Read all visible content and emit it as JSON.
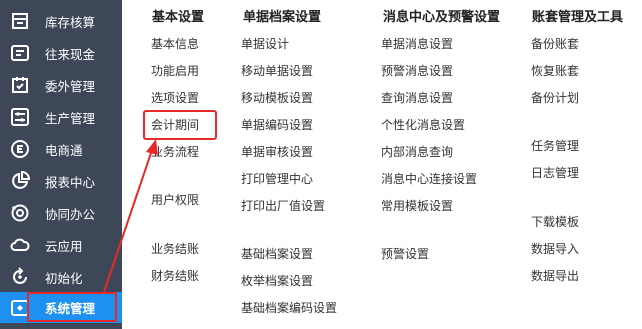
{
  "sidebar": {
    "items": [
      {
        "label": "库存核算",
        "icon": "inventory-icon"
      },
      {
        "label": "往来现金",
        "icon": "cash-icon"
      },
      {
        "label": "委外管理",
        "icon": "outsource-icon"
      },
      {
        "label": "生产管理",
        "icon": "production-icon"
      },
      {
        "label": "电商通",
        "icon": "ecommerce-icon"
      },
      {
        "label": "报表中心",
        "icon": "pie-chart-icon"
      },
      {
        "label": "协同办公",
        "icon": "collaboration-icon"
      },
      {
        "label": "云应用",
        "icon": "cloud-icon"
      },
      {
        "label": "初始化",
        "icon": "refresh-icon"
      },
      {
        "label": "系统管理",
        "icon": "system-icon",
        "active": true
      }
    ]
  },
  "menu": {
    "columns": [
      {
        "title": "基本设置",
        "items": [
          "基本信息",
          "功能启用",
          "选项设置",
          "会计期间",
          "业务流程",
          "用户权限",
          "业务结账",
          "财务结账"
        ]
      },
      {
        "title": "单据档案设置",
        "items": [
          "单据设计",
          "移动单据设置",
          "移动模板设置",
          "单据编码设置",
          "单据审核设置",
          "打印管理中心",
          "打印出厂值设置",
          "基础档案设置",
          "枚举档案设置",
          "基础档案编码设置"
        ]
      },
      {
        "title": "消息中心及预警设置",
        "items": [
          "单据消息设置",
          "预警消息设置",
          "查询消息设置",
          "个性化消息设置",
          "内部消息查询",
          "消息中心连接设置",
          "常用模板设置",
          "预警设置"
        ]
      },
      {
        "title": "账套管理及工具",
        "items": [
          "备份账套",
          "恢复账套",
          "备份计划",
          "任务管理",
          "日志管理",
          "下载模板",
          "数据导入",
          "数据导出"
        ]
      }
    ]
  },
  "annotation": {
    "color": "#e52a27"
  },
  "colors": {
    "sidebar_bg": "#3d4757",
    "active_bg": "#1e90ef"
  }
}
